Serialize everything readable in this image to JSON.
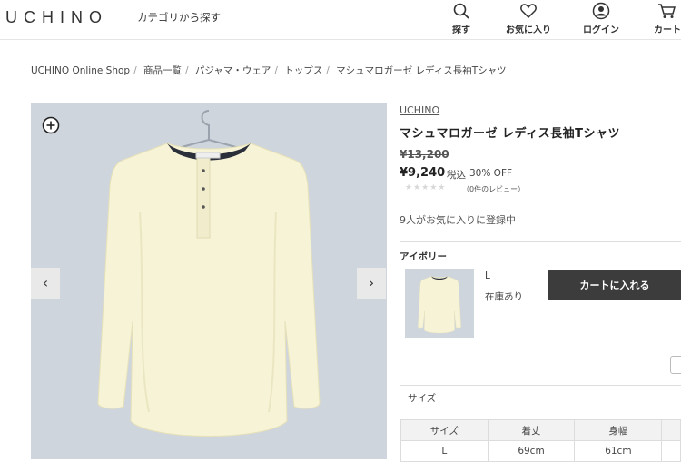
{
  "header": {
    "logo": "UCHINO",
    "category_link": "カテゴリから探す",
    "nav": [
      {
        "label": "探す",
        "icon": "search-icon"
      },
      {
        "label": "お気に入り",
        "icon": "heart-icon"
      },
      {
        "label": "ログイン",
        "icon": "user-icon"
      },
      {
        "label": "カート",
        "icon": "cart-icon"
      }
    ]
  },
  "breadcrumb": [
    "UCHINO Online Shop",
    "商品一覧",
    "パジャマ・ウェア",
    "トップス",
    "マシュマロガーゼ レディス長袖Tシャツ"
  ],
  "product": {
    "brand": "UCHINO",
    "name": "マシュマロガーゼ レディス長袖Tシャツ",
    "original_price": "¥13,200",
    "price": "¥9,240",
    "tax_label": "税込",
    "discount": "30% OFF",
    "rating_stars": "★★★★★",
    "reviews": "（0件のレビュー）",
    "favorites": "9人がお気に入りに登録中"
  },
  "variant": {
    "color": "アイボリー",
    "size": "L",
    "stock": "在庫あり",
    "cart_button": "カートに入れる"
  },
  "size_section": {
    "heading": "サイズ",
    "columns": [
      "サイズ",
      "着丈",
      "身幅"
    ],
    "rows": [
      [
        "L",
        "69cm",
        "61cm"
      ]
    ]
  },
  "colors": {
    "photo_bg": "#cfd5dd",
    "shirt": "#f6f3d6",
    "button": "#3c3c3c"
  }
}
